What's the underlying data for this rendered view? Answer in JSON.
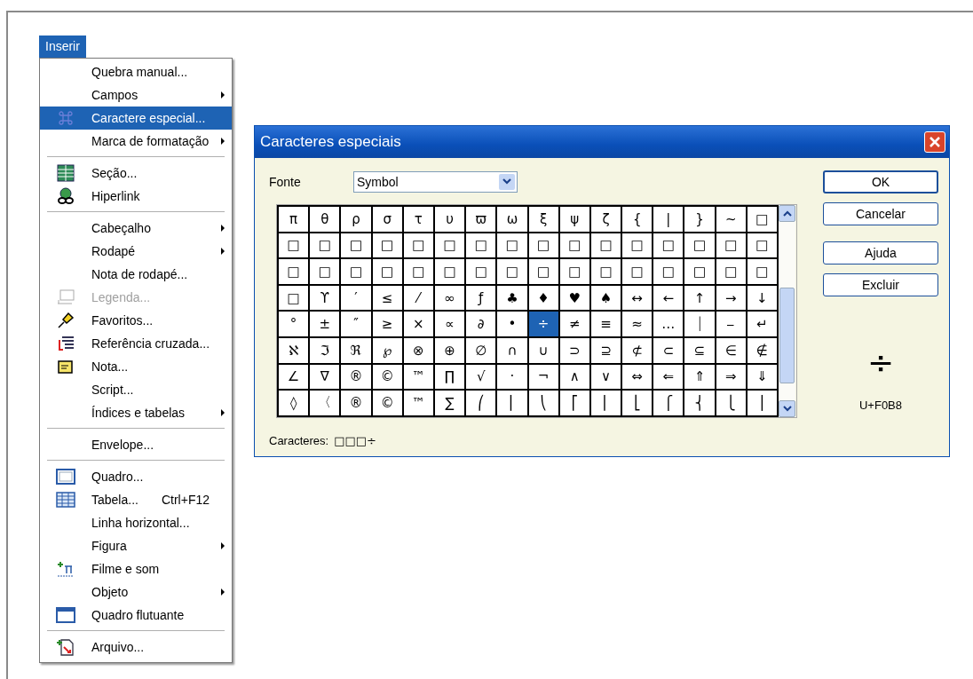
{
  "menu": {
    "title": "Inserir",
    "groups": [
      [
        {
          "label": "Quebra manual...",
          "submenu": false,
          "selected": false,
          "disabled": false
        },
        {
          "label": "Campos",
          "submenu": true,
          "selected": false,
          "disabled": false
        },
        {
          "label": "Caractere especial...",
          "submenu": false,
          "selected": true,
          "disabled": false
        },
        {
          "label": "Marca de formatação",
          "submenu": true,
          "selected": false,
          "disabled": false
        }
      ],
      [
        {
          "label": "Seção...",
          "submenu": false,
          "selected": false,
          "disabled": false
        },
        {
          "label": "Hiperlink",
          "submenu": false,
          "selected": false,
          "disabled": false
        }
      ],
      [
        {
          "label": "Cabeçalho",
          "submenu": true,
          "selected": false,
          "disabled": false
        },
        {
          "label": "Rodapé",
          "submenu": true,
          "selected": false,
          "disabled": false
        },
        {
          "label": "Nota de rodapé...",
          "submenu": false,
          "selected": false,
          "disabled": false
        },
        {
          "label": "Legenda...",
          "submenu": false,
          "selected": false,
          "disabled": true
        },
        {
          "label": "Favoritos...",
          "submenu": false,
          "selected": false,
          "disabled": false
        },
        {
          "label": "Referência cruzada...",
          "submenu": false,
          "selected": false,
          "disabled": false
        },
        {
          "label": "Nota...",
          "submenu": false,
          "selected": false,
          "disabled": false
        },
        {
          "label": "Script...",
          "submenu": false,
          "selected": false,
          "disabled": false
        },
        {
          "label": "Índices e tabelas",
          "submenu": true,
          "selected": false,
          "disabled": false
        }
      ],
      [
        {
          "label": "Envelope...",
          "submenu": false,
          "selected": false,
          "disabled": false
        }
      ],
      [
        {
          "label": "Quadro...",
          "submenu": false,
          "selected": false,
          "disabled": false
        },
        {
          "label": "Tabela...",
          "shortcut": "Ctrl+F12",
          "submenu": false,
          "selected": false,
          "disabled": false
        },
        {
          "label": "Linha horizontal...",
          "submenu": false,
          "selected": false,
          "disabled": false
        },
        {
          "label": "Figura",
          "submenu": true,
          "selected": false,
          "disabled": false
        },
        {
          "label": "Filme e som",
          "submenu": false,
          "selected": false,
          "disabled": false
        },
        {
          "label": "Objeto",
          "submenu": true,
          "selected": false,
          "disabled": false
        },
        {
          "label": "Quadro flutuante",
          "submenu": false,
          "selected": false,
          "disabled": false
        }
      ],
      [
        {
          "label": "Arquivo...",
          "submenu": false,
          "selected": false,
          "disabled": false
        }
      ]
    ]
  },
  "dialog": {
    "title": "Caracteres especiais",
    "font_label": "Fonte",
    "font_value": "Symbol",
    "grid": [
      [
        {
          "char": "π",
          "selected": false
        },
        {
          "char": "θ",
          "selected": false
        },
        {
          "char": "ρ",
          "selected": false
        },
        {
          "char": "σ",
          "selected": false
        },
        {
          "char": "τ",
          "selected": false
        },
        {
          "char": "υ",
          "selected": false
        },
        {
          "char": "ϖ",
          "selected": false
        },
        {
          "char": "ω",
          "selected": false
        },
        {
          "char": "ξ",
          "selected": false
        },
        {
          "char": "ψ",
          "selected": false
        },
        {
          "char": "ζ",
          "selected": false
        },
        {
          "char": "{",
          "selected": false
        },
        {
          "char": "|",
          "selected": false
        },
        {
          "char": "}",
          "selected": false
        },
        {
          "char": "~",
          "selected": false
        },
        {
          "char": "□",
          "selected": false
        }
      ],
      [
        {
          "char": "□",
          "selected": false
        },
        {
          "char": "□",
          "selected": false
        },
        {
          "char": "□",
          "selected": false
        },
        {
          "char": "□",
          "selected": false
        },
        {
          "char": "□",
          "selected": false
        },
        {
          "char": "□",
          "selected": false
        },
        {
          "char": "□",
          "selected": false
        },
        {
          "char": "□",
          "selected": false
        },
        {
          "char": "□",
          "selected": false
        },
        {
          "char": "□",
          "selected": false
        },
        {
          "char": "□",
          "selected": false
        },
        {
          "char": "□",
          "selected": false
        },
        {
          "char": "□",
          "selected": false
        },
        {
          "char": "□",
          "selected": false
        },
        {
          "char": "□",
          "selected": false
        },
        {
          "char": "□",
          "selected": false
        }
      ],
      [
        {
          "char": "□",
          "selected": false
        },
        {
          "char": "□",
          "selected": false
        },
        {
          "char": "□",
          "selected": false
        },
        {
          "char": "□",
          "selected": false
        },
        {
          "char": "□",
          "selected": false
        },
        {
          "char": "□",
          "selected": false
        },
        {
          "char": "□",
          "selected": false
        },
        {
          "char": "□",
          "selected": false
        },
        {
          "char": "□",
          "selected": false
        },
        {
          "char": "□",
          "selected": false
        },
        {
          "char": "□",
          "selected": false
        },
        {
          "char": "□",
          "selected": false
        },
        {
          "char": "□",
          "selected": false
        },
        {
          "char": "□",
          "selected": false
        },
        {
          "char": "□",
          "selected": false
        },
        {
          "char": "□",
          "selected": false
        }
      ],
      [
        {
          "char": "□",
          "selected": false
        },
        {
          "char": "ϒ",
          "selected": false
        },
        {
          "char": "′",
          "selected": false
        },
        {
          "char": "≤",
          "selected": false
        },
        {
          "char": "⁄",
          "selected": false
        },
        {
          "char": "∞",
          "selected": false
        },
        {
          "char": "ƒ",
          "selected": false
        },
        {
          "char": "♣",
          "selected": false
        },
        {
          "char": "♦",
          "selected": false
        },
        {
          "char": "♥",
          "selected": false
        },
        {
          "char": "♠",
          "selected": false
        },
        {
          "char": "↔",
          "selected": false
        },
        {
          "char": "←",
          "selected": false
        },
        {
          "char": "↑",
          "selected": false
        },
        {
          "char": "→",
          "selected": false
        },
        {
          "char": "↓",
          "selected": false
        }
      ],
      [
        {
          "char": "°",
          "selected": false
        },
        {
          "char": "±",
          "selected": false
        },
        {
          "char": "″",
          "selected": false
        },
        {
          "char": "≥",
          "selected": false
        },
        {
          "char": "×",
          "selected": false
        },
        {
          "char": "∝",
          "selected": false
        },
        {
          "char": "∂",
          "selected": false
        },
        {
          "char": "•",
          "selected": false
        },
        {
          "char": "÷",
          "selected": true
        },
        {
          "char": "≠",
          "selected": false
        },
        {
          "char": "≡",
          "selected": false
        },
        {
          "char": "≈",
          "selected": false
        },
        {
          "char": "…",
          "selected": false
        },
        {
          "char": "⏐",
          "selected": false
        },
        {
          "char": "⎯",
          "selected": false
        },
        {
          "char": "↵",
          "selected": false
        }
      ],
      [
        {
          "char": "ℵ",
          "selected": false
        },
        {
          "char": "ℑ",
          "selected": false
        },
        {
          "char": "ℜ",
          "selected": false
        },
        {
          "char": "℘",
          "selected": false
        },
        {
          "char": "⊗",
          "selected": false
        },
        {
          "char": "⊕",
          "selected": false
        },
        {
          "char": "∅",
          "selected": false
        },
        {
          "char": "∩",
          "selected": false
        },
        {
          "char": "∪",
          "selected": false
        },
        {
          "char": "⊃",
          "selected": false
        },
        {
          "char": "⊇",
          "selected": false
        },
        {
          "char": "⊄",
          "selected": false
        },
        {
          "char": "⊂",
          "selected": false
        },
        {
          "char": "⊆",
          "selected": false
        },
        {
          "char": "∈",
          "selected": false
        },
        {
          "char": "∉",
          "selected": false
        }
      ],
      [
        {
          "char": "∠",
          "selected": false
        },
        {
          "char": "∇",
          "selected": false
        },
        {
          "char": "®",
          "selected": false
        },
        {
          "char": "©",
          "selected": false
        },
        {
          "char": "™",
          "selected": false
        },
        {
          "char": "∏",
          "selected": false
        },
        {
          "char": "√",
          "selected": false
        },
        {
          "char": "·",
          "selected": false
        },
        {
          "char": "¬",
          "selected": false
        },
        {
          "char": "∧",
          "selected": false
        },
        {
          "char": "∨",
          "selected": false
        },
        {
          "char": "⇔",
          "selected": false
        },
        {
          "char": "⇐",
          "selected": false
        },
        {
          "char": "⇑",
          "selected": false
        },
        {
          "char": "⇒",
          "selected": false
        },
        {
          "char": "⇓",
          "selected": false
        }
      ],
      [
        {
          "char": "◊",
          "selected": false
        },
        {
          "char": "〈",
          "selected": false
        },
        {
          "char": "®",
          "selected": false
        },
        {
          "char": "©",
          "selected": false
        },
        {
          "char": "™",
          "selected": false
        },
        {
          "char": "∑",
          "selected": false
        },
        {
          "char": "⎛",
          "selected": false
        },
        {
          "char": "⎜",
          "selected": false
        },
        {
          "char": "⎝",
          "selected": false
        },
        {
          "char": "⎡",
          "selected": false
        },
        {
          "char": "⎢",
          "selected": false
        },
        {
          "char": "⎣",
          "selected": false
        },
        {
          "char": "⎧",
          "selected": false
        },
        {
          "char": "⎨",
          "selected": false
        },
        {
          "char": "⎩",
          "selected": false
        },
        {
          "char": "⎪",
          "selected": false
        }
      ]
    ],
    "characters_label": "Caracteres:",
    "characters_value": "□□□÷",
    "buttons": [
      "OK",
      "Cancelar",
      "Ajuda",
      "Excluir"
    ],
    "preview_char": "÷",
    "preview_code": "U+F0B8"
  }
}
